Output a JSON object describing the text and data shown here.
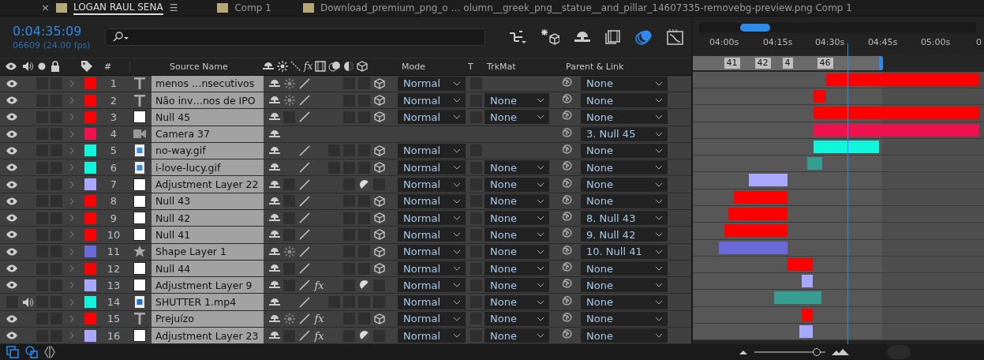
{
  "tabs": [
    {
      "label": "LOGAN RAUL SENA",
      "selected": true,
      "close": "×",
      "menu": "☰"
    },
    {
      "label": "Comp 1",
      "selected": false
    },
    {
      "label": "Download_premium_png_o … olumn__greek_png__statue__and_pillar_14607335-removebg-preview.png Comp 1",
      "selected": false
    }
  ],
  "timecode": "0:04:35:09",
  "frame_info": "06609 (24.00 fps)",
  "columns": {
    "number": "#",
    "source_name": "Source Name",
    "fx": "fx",
    "mode": "Mode",
    "t": "T",
    "trkmat": "TrkMat",
    "parent": "Parent & Link"
  },
  "ruler": [
    "04:00s",
    "04:15s",
    "04:30s",
    "04:45s",
    "05:00s",
    "0"
  ],
  "markers": [
    "41",
    "42",
    "4",
    "46"
  ],
  "zoom_slider": {
    "level": 0.88
  },
  "layers": [
    {
      "number": "1",
      "name": "menos …nsecutivos",
      "kind": "text",
      "color": "#ff0000",
      "video": true,
      "audio": false,
      "solo": false,
      "locked": false,
      "collapse": true,
      "motion_blur": false,
      "adjustment": false,
      "three_d": true,
      "mode": "Normal",
      "preserve_transparency": false,
      "parent": "None"
    },
    {
      "number": "2",
      "name": "Não inv…nos de IPO",
      "kind": "text",
      "color": "#ff0000",
      "video": true,
      "audio": false,
      "solo": false,
      "locked": false,
      "collapse": true,
      "motion_blur": false,
      "adjustment": false,
      "three_d": true,
      "mode": "Normal",
      "preserve_transparency": false,
      "trkmat": "None",
      "parent": "None"
    },
    {
      "number": "3",
      "name": "Null 45",
      "kind": "null",
      "color": "#ff0000",
      "video": true,
      "audio": false,
      "solo": false,
      "locked": false,
      "collapse": false,
      "motion_blur": false,
      "adjustment": false,
      "three_d": true,
      "mode": "Normal",
      "preserve_transparency": false,
      "trkmat": "None",
      "parent": "None"
    },
    {
      "number": "4",
      "name": "Camera 37",
      "kind": "camera",
      "color": "#f0104e",
      "video": true,
      "audio": false,
      "solo": false,
      "locked": false,
      "parent": "3. Null 45"
    },
    {
      "number": "5",
      "name": "no-way.gif",
      "kind": "footage",
      "color": "#10f5dc",
      "video": true,
      "audio": false,
      "solo": false,
      "locked": false,
      "frame_blend": false,
      "motion_blur": false,
      "adjustment": false,
      "three_d": true,
      "mode": "Normal",
      "preserve_transparency": false,
      "parent": "None"
    },
    {
      "number": "6",
      "name": "i-love-lucy.gif",
      "kind": "footage",
      "color": "#10f5dc",
      "video": true,
      "audio": false,
      "solo": false,
      "locked": false,
      "frame_blend": false,
      "motion_blur": false,
      "adjustment": false,
      "three_d": true,
      "mode": "Normal",
      "preserve_transparency": false,
      "trkmat": "None",
      "parent": "None"
    },
    {
      "number": "7",
      "name": "Adjustment Layer 22",
      "kind": "solid",
      "color": "#a8a8ff",
      "video": true,
      "audio": false,
      "solo": false,
      "locked": false,
      "collapse": false,
      "motion_blur": false,
      "adjustment": true,
      "three_d": false,
      "mode": "Normal",
      "preserve_transparency": false,
      "trkmat": "None",
      "parent": "None"
    },
    {
      "number": "8",
      "name": "Null 43",
      "kind": "null",
      "color": "#ff0000",
      "video": true,
      "audio": false,
      "solo": false,
      "locked": false,
      "collapse": false,
      "motion_blur": false,
      "adjustment": false,
      "three_d": true,
      "mode": "Normal",
      "preserve_transparency": false,
      "trkmat": "None",
      "parent": "None"
    },
    {
      "number": "9",
      "name": "Null 42",
      "kind": "null",
      "color": "#ff0000",
      "video": true,
      "audio": false,
      "solo": false,
      "locked": false,
      "collapse": false,
      "motion_blur": false,
      "adjustment": false,
      "three_d": true,
      "mode": "Normal",
      "preserve_transparency": false,
      "trkmat": "None",
      "parent": "8. Null 43"
    },
    {
      "number": "10",
      "name": "Null 41",
      "kind": "null",
      "color": "#ff0000",
      "video": true,
      "audio": false,
      "solo": false,
      "locked": false,
      "collapse": false,
      "motion_blur": false,
      "adjustment": false,
      "three_d": true,
      "mode": "Normal",
      "preserve_transparency": false,
      "trkmat": "None",
      "parent": "9. Null 42"
    },
    {
      "number": "11",
      "name": "Shape Layer 1",
      "kind": "shape",
      "color": "#6a6ad8",
      "video": true,
      "audio": false,
      "solo": false,
      "locked": false,
      "collapse": true,
      "motion_blur": false,
      "adjustment": false,
      "three_d": true,
      "mode": "Normal",
      "preserve_transparency": false,
      "trkmat": "None",
      "parent": "10. Null 41"
    },
    {
      "number": "12",
      "name": "Null 44",
      "kind": "null",
      "color": "#ff0000",
      "video": true,
      "audio": false,
      "solo": false,
      "locked": false,
      "collapse": false,
      "motion_blur": false,
      "adjustment": false,
      "three_d": true,
      "mode": "Normal",
      "preserve_transparency": false,
      "trkmat": "None",
      "parent": "None"
    },
    {
      "number": "13",
      "name": "Adjustment Layer 9",
      "kind": "solid",
      "color": "#a8a8ff",
      "video": true,
      "audio": false,
      "solo": false,
      "locked": false,
      "collapse": false,
      "effects": "fx",
      "motion_blur": false,
      "adjustment": true,
      "three_d": false,
      "mode": "Normal",
      "preserve_transparency": false,
      "trkmat": "None",
      "parent": "None"
    },
    {
      "number": "14",
      "name": "SHUTTER 1.mp4",
      "kind": "video",
      "color": "#10f5dc",
      "video": false,
      "audio": true,
      "solo": false,
      "locked": false,
      "frame_blend": false,
      "motion_blur": false,
      "adjustment": false,
      "three_d": false,
      "mode": "Normal",
      "preserve_transparency": false,
      "trkmat": "None",
      "parent": "None"
    },
    {
      "number": "15",
      "name": "Prejuízo",
      "kind": "text",
      "color": "#ff0000",
      "video": true,
      "audio": false,
      "solo": false,
      "locked": false,
      "collapse": true,
      "effects": "fx",
      "motion_blur": false,
      "adjustment": false,
      "three_d": true,
      "mode": "Normal",
      "preserve_transparency": false,
      "trkmat": "None",
      "parent": "None"
    },
    {
      "number": "16",
      "name": "Adjustment Layer 23",
      "kind": "solid",
      "color": "#a8a8ff",
      "video": true,
      "audio": false,
      "solo": false,
      "locked": false,
      "collapse": false,
      "effects": "fx",
      "motion_blur": false,
      "adjustment": true,
      "three_d": false,
      "mode": "Normal",
      "preserve_transparency": false,
      "trkmat": "None",
      "parent": "None"
    }
  ]
}
